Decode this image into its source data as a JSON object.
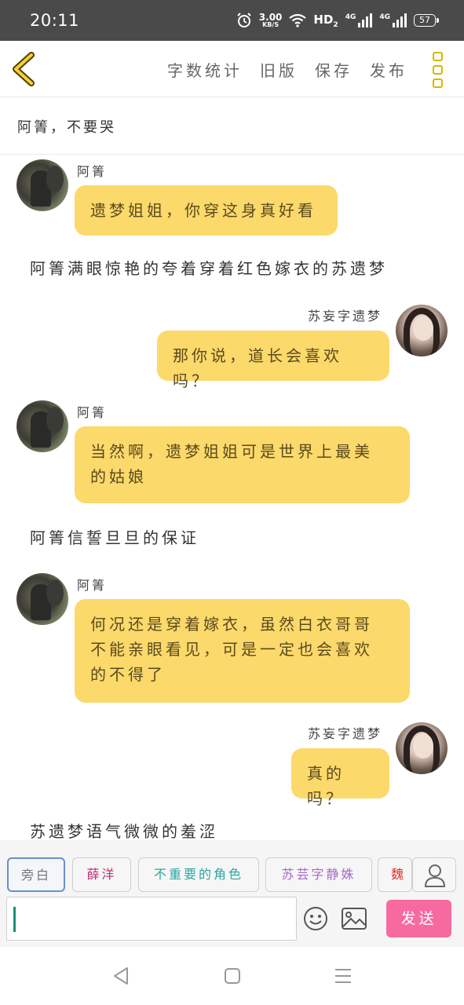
{
  "status": {
    "time": "20:11",
    "net_speed": "3.00",
    "net_unit": "KB/S",
    "hd": "HD",
    "hd_sub": "2",
    "sig1": "4G",
    "sig2": "4G",
    "battery": "57",
    "icons": [
      "alarm-icon",
      "wifi-icon",
      "signal-icon",
      "battery-icon"
    ]
  },
  "toolbar": {
    "back_icon": "chevron-left-icon",
    "word_count": "字数统计",
    "old_version": "旧版",
    "save": "保存",
    "publish": "发布",
    "more_icon": "more-vertical-icon",
    "accent": "#d6b600"
  },
  "title": "阿箐，不要哭",
  "messages": [
    {
      "side": "left",
      "name": "阿箐",
      "lines": [
        "遗梦姐姐，你穿这身真好看"
      ]
    },
    {
      "side": "narration",
      "text": "阿箐满眼惊艳的夸着穿着红色嫁衣的苏遗梦"
    },
    {
      "side": "right",
      "name": "苏妄字遗梦",
      "lines": [
        "那你说，道长会喜欢吗？"
      ]
    },
    {
      "side": "left",
      "name": "阿箐",
      "lines": [
        "当然啊，遗梦姐姐可是世界上最美",
        "的姑娘"
      ]
    },
    {
      "side": "narration",
      "text": "阿箐信誓旦旦的保证"
    },
    {
      "side": "left",
      "name": "阿箐",
      "lines": [
        "何况还是穿着嫁衣，虽然白衣哥哥",
        "不能亲眼看见，可是一定也会喜欢",
        "的不得了"
      ]
    },
    {
      "side": "right",
      "name": "苏妄字遗梦",
      "lines": [
        "真的吗？"
      ]
    },
    {
      "side": "narration",
      "text": "苏遗梦语气微微的羞涩"
    }
  ],
  "roles": [
    {
      "label": "旁白",
      "color": "#777777",
      "selected": true
    },
    {
      "label": "薛洋",
      "color": "#c0307a",
      "selected": false
    },
    {
      "label": "不重要的角色",
      "color": "#2aa6a0",
      "selected": false
    },
    {
      "label": "苏芸字静姝",
      "color": "#a66ac9",
      "selected": false
    },
    {
      "label": "魏",
      "color": "#e0312b",
      "selected": false
    }
  ],
  "input": {
    "value": "",
    "send_label": "发送",
    "send_color": "#f76aa0",
    "emoji_icon": "emoji-icon",
    "image_icon": "image-icon",
    "user_icon": "user-icon"
  },
  "nav": {
    "back_icon": "nav-back-icon",
    "home_icon": "nav-home-icon",
    "menu_icon": "nav-menu-icon"
  },
  "colors": {
    "bubble": "#fcd96b",
    "status_bar": "#4a4a4a"
  }
}
